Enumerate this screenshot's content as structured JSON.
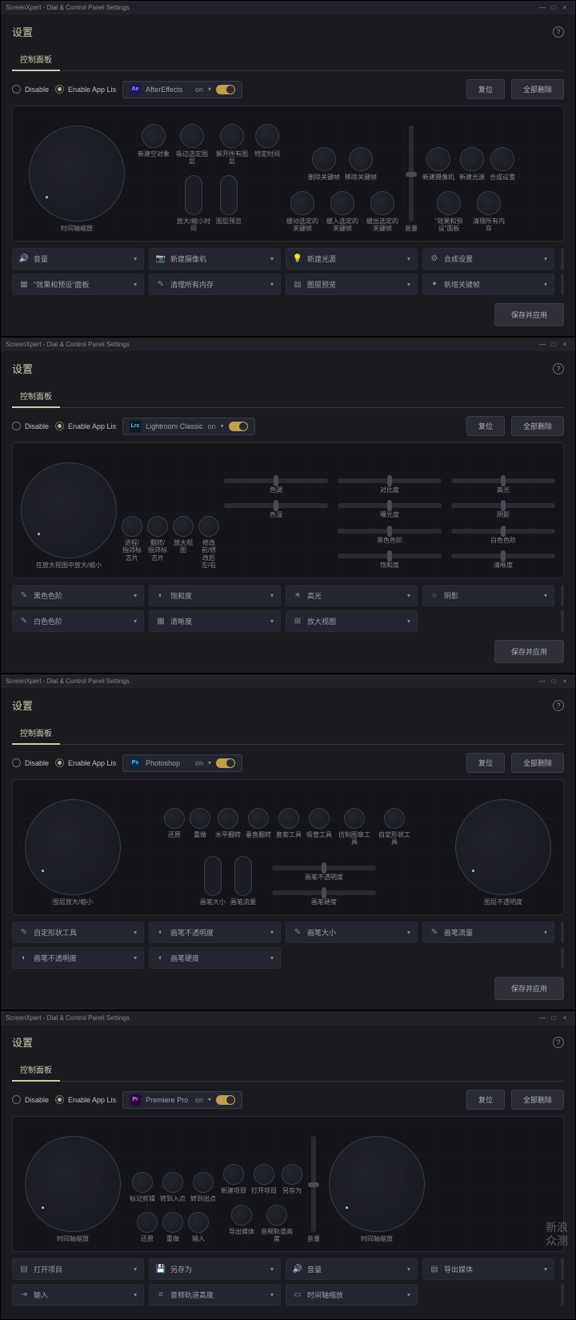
{
  "titlebar": "ScreenXpert - Dial & Control Panel Settings",
  "settings_title": "设置",
  "tab_label": "控制面板",
  "disable_label": "Disable",
  "enable_label": "Enable App Lis",
  "on_label": "on",
  "reset_btn": "复位",
  "delete_all_btn": "全部删除",
  "save_apply_btn": "保存并应用",
  "watermark_line1": "新浪",
  "watermark_line2": "众测",
  "panels": [
    {
      "app": {
        "name": "AfterEffects",
        "icon_bg": "#1a1a5a",
        "icon_fg": "#9999ff",
        "icon_text": "Ae"
      },
      "bigdial_label": "时间轴缩放",
      "knobs": [
        [
          "新建空对象",
          "吸边选定图层",
          "解开所有图层",
          "特定时间"
        ],
        [
          "删除关键帧",
          "移除关键帧"
        ],
        [
          "新建摄像机",
          "新建光源",
          "合成设置"
        ]
      ],
      "pills": [
        "放大/缩小时间",
        "图层预览"
      ],
      "knobs2": [
        [
          "缓动选定的关键帧",
          "缓入选定的关键帧",
          "缓出选定的关键帧"
        ]
      ],
      "vslider_label": "音量",
      "rightknobs": [
        "\"效果和预设\"面板",
        "清理所有内存"
      ],
      "selects": [
        [
          {
            "icon": "🔊",
            "label": "音量"
          },
          {
            "icon": "📷",
            "label": "新建摄像机"
          },
          {
            "icon": "💡",
            "label": "新建光源"
          },
          {
            "icon": "⚙",
            "label": "合成设置"
          }
        ],
        [
          {
            "icon": "▦",
            "label": "\"效果和预设\"面板"
          },
          {
            "icon": "✎",
            "label": "清理所有内存"
          },
          {
            "icon": "▤",
            "label": "图层预览"
          },
          {
            "icon": "✦",
            "label": "新增关键帧"
          }
        ]
      ]
    },
    {
      "app": {
        "name": "Lightroom Classic",
        "icon_bg": "#0a1a2a",
        "icon_fg": "#7ab8d8",
        "icon_text": "Lrc"
      },
      "bigdial_label": "在放大视图中放大/缩小",
      "knobs_small": [
        "进程/指郊标志片",
        "翻转/指郊标志片",
        "放大视图",
        "修改前/修改后 左/右"
      ],
      "hsliders": [
        [
          "色调",
          "对比度",
          "高光"
        ],
        [
          "色温",
          "曝光度",
          "阴影"
        ],
        [
          "黑色色阶",
          "白色色阶"
        ],
        [
          "饱和度",
          "清晰度"
        ]
      ],
      "selects": [
        [
          {
            "icon": "✎",
            "label": "黑色色阶"
          },
          {
            "icon": "◐",
            "label": "饱和度"
          },
          {
            "icon": "☀",
            "label": "高光"
          },
          {
            "icon": "○",
            "label": "阴影"
          }
        ],
        [
          {
            "icon": "✎",
            "label": "白色色阶"
          },
          {
            "icon": "▦",
            "label": "清晰度"
          },
          {
            "icon": "⊞",
            "label": "放大视图"
          }
        ]
      ]
    },
    {
      "app": {
        "name": "Photoshop",
        "icon_bg": "#0a2a4a",
        "icon_fg": "#5ac8fa",
        "icon_text": "Ps"
      },
      "bigdial_label": "图层放大/缩小",
      "bigdial2_label": "图层不透明度",
      "knobs_top": [
        "还原",
        "重做",
        "水平翻转",
        "垂直翻转",
        "套索工具",
        "吸管工具",
        "仿制图章工具",
        "自定形状工具"
      ],
      "pills": [
        "画笔大小",
        "画笔流量"
      ],
      "hsliders_right": [
        "画笔不透明度",
        "画笔硬度"
      ],
      "selects": [
        [
          {
            "icon": "✎",
            "label": "自定形状工具"
          },
          {
            "icon": "◐",
            "label": "画笔不透明度"
          },
          {
            "icon": "✎",
            "label": "画笔大小"
          },
          {
            "icon": "✎",
            "label": "画笔流量"
          }
        ],
        [
          {
            "icon": "◐",
            "label": "画笔不透明度"
          },
          {
            "icon": "◐",
            "label": "画笔硬度"
          }
        ]
      ]
    },
    {
      "app": {
        "name": "Premiere Pro",
        "icon_bg": "#2a0a3a",
        "icon_fg": "#e878ff",
        "icon_text": "Pr"
      },
      "bigdial_label": "时间轴缩放",
      "bigdial2_label": "时间轴缩放",
      "knobs_mid": [
        [
          "标记剪辑",
          "转到入点",
          "转到出点"
        ],
        [
          "新建项目",
          "打开项目",
          "另存为"
        ]
      ],
      "knobs_bot": [
        [
          "还原",
          "重做",
          "输入"
        ],
        [
          "导出媒体",
          "音频轨道高度"
        ]
      ],
      "vslider_label": "音量",
      "selects": [
        [
          {
            "icon": "▤",
            "label": "打开项目"
          },
          {
            "icon": "💾",
            "label": "另存为"
          },
          {
            "icon": "🔊",
            "label": "音量"
          },
          {
            "icon": "▤",
            "label": "导出媒体"
          }
        ],
        [
          {
            "icon": "⇥",
            "label": "输入"
          },
          {
            "icon": "≡",
            "label": "音频轨道高度"
          },
          {
            "icon": "▭",
            "label": "时间轴缩放"
          }
        ]
      ]
    }
  ]
}
